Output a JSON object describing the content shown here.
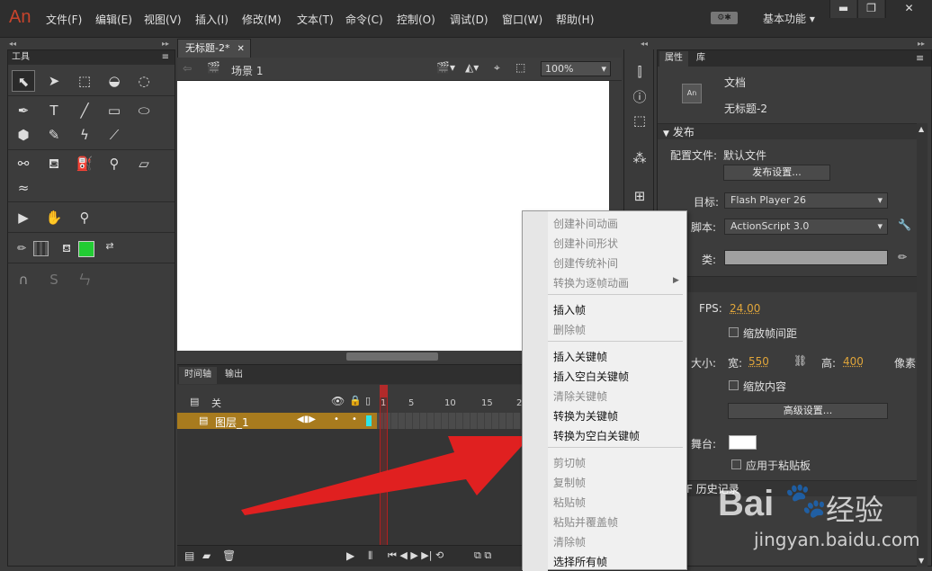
{
  "app": {
    "logo": "An"
  },
  "menu": [
    "文件(F)",
    "编辑(E)",
    "视图(V)",
    "插入(I)",
    "修改(M)",
    "文本(T)",
    "命令(C)",
    "控制(O)",
    "调试(D)",
    "窗口(W)",
    "帮助(H)"
  ],
  "workspace": {
    "label": "基本功能"
  },
  "tools": {
    "title": "工具"
  },
  "document": {
    "tab": "无标题-2*",
    "scene": "场景 1",
    "zoom": "100%"
  },
  "timeline": {
    "tabs": [
      "时间轴",
      "输出"
    ],
    "header_label": "关",
    "layer": "图层_1",
    "frame_numbers": [
      "1",
      "5",
      "10",
      "15",
      "2"
    ]
  },
  "properties": {
    "tabs": [
      "属性",
      "库"
    ],
    "doc_type": "文档",
    "doc_name": "无标题-2",
    "publish_header": "发布",
    "profile_label": "配置文件:",
    "profile_value": "默认文件",
    "publish_settings": "发布设置...",
    "target_label": "目标:",
    "target_value": "Flash Player 26",
    "script_label": "脚本:",
    "script_value": "ActionScript 3.0",
    "class_label": "类:",
    "props_header": "性",
    "fps_label": "FPS:",
    "fps_value": "24.00",
    "scale_spans": "缩放帧间距",
    "size_label": "大小:",
    "width_label": "宽:",
    "width_value": "550",
    "height_label": "高:",
    "height_value": "400",
    "unit": "像素",
    "scale_content": "缩放内容",
    "advanced": "高级设置...",
    "stage_label": "舞台:",
    "apply_clipboard": "应用于粘贴板",
    "history_header": "F 历史记录"
  },
  "context_menu": [
    {
      "label": "创建补间动画",
      "disabled": true
    },
    {
      "label": "创建补间形状",
      "disabled": true
    },
    {
      "label": "创建传统补间",
      "disabled": true
    },
    {
      "label": "转换为逐帧动画",
      "disabled": true,
      "submenu": true
    },
    {
      "label": "插入帧",
      "disabled": false
    },
    {
      "label": "删除帧",
      "disabled": true
    },
    {
      "label": "插入关键帧",
      "disabled": false
    },
    {
      "label": "插入空白关键帧",
      "disabled": false
    },
    {
      "label": "清除关键帧",
      "disabled": true
    },
    {
      "label": "转换为关键帧",
      "disabled": false
    },
    {
      "label": "转换为空白关键帧",
      "disabled": false
    },
    {
      "label": "剪切帧",
      "disabled": true
    },
    {
      "label": "复制帧",
      "disabled": true
    },
    {
      "label": "粘贴帧",
      "disabled": true
    },
    {
      "label": "粘贴并覆盖帧",
      "disabled": true
    },
    {
      "label": "清除帧",
      "disabled": true
    },
    {
      "label": "选择所有帧",
      "disabled": false
    }
  ],
  "watermark": {
    "brand": "Bai",
    "brand2": "经验",
    "url": "jingyan.baidu.com"
  },
  "colors": {
    "fill": "#22cc33",
    "layer": "#a87b1e",
    "arrow": "#e02020"
  }
}
